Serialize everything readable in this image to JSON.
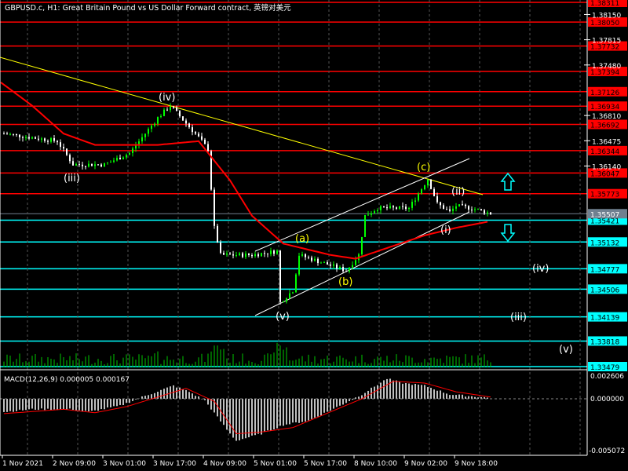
{
  "title": "GBPUSD.c, H1:  Great Britain Pound vs US Dollar Forward contract, 英镑对美元",
  "colors": {
    "bg": "#000000",
    "bull": "#00ff00",
    "bear": "#ffffff",
    "ma": "#ff0000",
    "trend": "#ffff00",
    "channel": "#ffffff",
    "resistance": "#ff0000",
    "support": "#00ffff",
    "volume": "#00c800",
    "macd_hist": "#c0c0c0",
    "macd_signal": "#ff0000",
    "current": "#708090"
  },
  "price_axis_ticks": [
    "1.38150",
    "1.37815",
    "1.37480",
    "1.36810",
    "1.36475",
    "1.36140"
  ],
  "resistance_levels": [
    "1.38311",
    "1.38050",
    "1.37732",
    "1.37394",
    "1.37126",
    "1.36934",
    "1.36692",
    "1.36344",
    "1.36047",
    "1.35773"
  ],
  "support_levels": [
    "1.35421",
    "1.35132",
    "1.34777",
    "1.34506",
    "1.34139",
    "1.33818",
    "1.33479"
  ],
  "current_price": "1.35507",
  "time_axis": [
    "1 Nov 2021",
    "2 Nov 09:00",
    "3 Nov 01:00",
    "3 Nov 17:00",
    "4 Nov 09:00",
    "5 Nov 01:00",
    "5 Nov 17:00",
    "8 Nov 10:00",
    "9 Nov 02:00",
    "9 Nov 18:00"
  ],
  "wave_labels": {
    "w_iii": "(iii)",
    "w_iv": "(iv)",
    "w_v": "(v)",
    "w_a": "(a)",
    "w_b": "(b)",
    "w_c": "(c)",
    "w_i": "(i)",
    "w_ii": "(ii)",
    "p_iv": "(iv)",
    "p_iii": "(iii)",
    "p_v": "(v)"
  },
  "arrows": {
    "up": "arrow-up",
    "down": "arrow-down"
  },
  "macd": {
    "label": "MACD(12,26,9) 0.000005 0.000167",
    "max_label": "0.002606",
    "zero_label": "0.000000",
    "min_label": "-0.005072"
  },
  "chart_data": {
    "type": "candlestick",
    "symbol": "GBPUSD.c",
    "timeframe": "H1",
    "ylim": [
      1.33479,
      1.38311
    ],
    "close_keypoints": [
      [
        0,
        1.3657
      ],
      [
        17,
        1.3647
      ],
      [
        22,
        1.3616
      ],
      [
        32,
        1.3616
      ],
      [
        40,
        1.3631
      ],
      [
        49,
        1.3678
      ],
      [
        53,
        1.3694
      ],
      [
        62,
        1.3652
      ],
      [
        65,
        1.3636
      ],
      [
        67,
        1.3532
      ],
      [
        69,
        1.3496
      ],
      [
        79,
        1.3496
      ],
      [
        87,
        1.3501
      ],
      [
        88,
        1.3433
      ],
      [
        92,
        1.3449
      ],
      [
        94,
        1.3496
      ],
      [
        102,
        1.3485
      ],
      [
        109,
        1.3475
      ],
      [
        113,
        1.3496
      ],
      [
        115,
        1.3548
      ],
      [
        119,
        1.3558
      ],
      [
        129,
        1.3558
      ],
      [
        135,
        1.3597
      ],
      [
        138,
        1.3564
      ],
      [
        142,
        1.3553
      ],
      [
        144,
        1.3561
      ],
      [
        149,
        1.3558
      ],
      [
        155,
        1.3551
      ]
    ],
    "ma_keypoints": [
      [
        -1,
        1.3725
      ],
      [
        9,
        1.3694
      ],
      [
        19,
        1.3657
      ],
      [
        29,
        1.3642
      ],
      [
        49,
        1.3642
      ],
      [
        62,
        1.3647
      ],
      [
        72,
        1.3595
      ],
      [
        79,
        1.3548
      ],
      [
        89,
        1.3511
      ],
      [
        104,
        1.3496
      ],
      [
        112,
        1.3491
      ],
      [
        119,
        1.3501
      ],
      [
        134,
        1.3522
      ],
      [
        144,
        1.3532
      ],
      [
        154,
        1.354
      ]
    ],
    "macd_hist_keypoints": [
      [
        0,
        -0.0015
      ],
      [
        9,
        -0.0012
      ],
      [
        22,
        -0.0012
      ],
      [
        27,
        -0.0015
      ],
      [
        37,
        -0.0008
      ],
      [
        44,
        0.0002
      ],
      [
        54,
        0.0015
      ],
      [
        59,
        0.0008
      ],
      [
        64,
        -0.0002
      ],
      [
        72,
        -0.004
      ],
      [
        74,
        -0.0048
      ],
      [
        82,
        -0.004
      ],
      [
        89,
        -0.003
      ],
      [
        97,
        -0.0025
      ],
      [
        107,
        -0.0008
      ],
      [
        114,
        0.0005
      ],
      [
        122,
        0.0023
      ],
      [
        127,
        0.0018
      ],
      [
        134,
        0.0015
      ],
      [
        142,
        0.0005
      ],
      [
        155,
        0.0001
      ]
    ],
    "macd_signal_keypoints": [
      [
        0,
        -0.0017
      ],
      [
        19,
        -0.0012
      ],
      [
        29,
        -0.0016
      ],
      [
        39,
        -0.0009
      ],
      [
        49,
        0.0002
      ],
      [
        58,
        0.0012
      ],
      [
        67,
        -0.0003
      ],
      [
        74,
        -0.004
      ],
      [
        82,
        -0.0038
      ],
      [
        92,
        -0.0033
      ],
      [
        104,
        -0.0015
      ],
      [
        114,
        0.0
      ],
      [
        124,
        0.002
      ],
      [
        134,
        0.0018
      ],
      [
        144,
        0.0008
      ],
      [
        155,
        0.0002
      ]
    ],
    "macd_ylim": [
      -0.005072,
      0.002606
    ]
  }
}
